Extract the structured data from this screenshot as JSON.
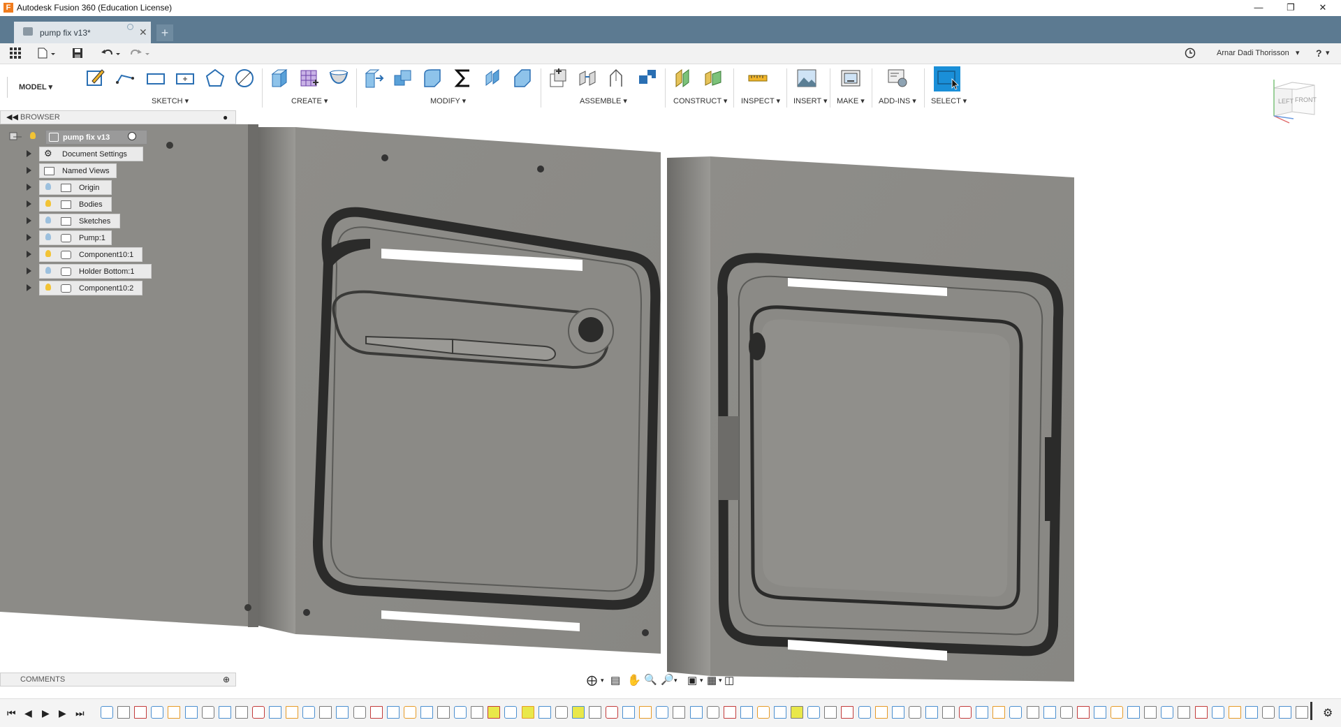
{
  "window": {
    "title": "Autodesk Fusion 360 (Education License)",
    "logo_letter": "F"
  },
  "tabs": [
    {
      "label": "pump fix v13*",
      "active": true
    }
  ],
  "quick_access": {
    "user_name": "Arnar Dadi Thorisson",
    "help_label": "?"
  },
  "toolbar": {
    "workspace": "MODEL",
    "groups": [
      "SKETCH",
      "CREATE",
      "MODIFY",
      "ASSEMBLE",
      "CONSTRUCT",
      "INSPECT",
      "INSERT",
      "MAKE",
      "ADD-INS",
      "SELECT"
    ],
    "accent": "#1a8fd8"
  },
  "viewcube": {
    "left": "LEFT",
    "front": "FRONT"
  },
  "browser": {
    "title": "BROWSER",
    "root": "pump fix v13",
    "items": [
      {
        "label": "Document Settings",
        "icon": "gear-icon"
      },
      {
        "label": "Named Views",
        "icon": "folder-icon"
      },
      {
        "label": "Origin",
        "icon": "folder-icon",
        "bulb": "off"
      },
      {
        "label": "Bodies",
        "icon": "folder-icon",
        "bulb": "on"
      },
      {
        "label": "Sketches",
        "icon": "folder-icon",
        "bulb": "off"
      },
      {
        "label": "Pump:1",
        "icon": "component-link-icon",
        "bulb": "off"
      },
      {
        "label": "Component10:1",
        "icon": "component-icon",
        "bulb": "on"
      },
      {
        "label": "Holder Bottom:1",
        "icon": "component-icon",
        "bulb": "off"
      },
      {
        "label": "Component10:2",
        "icon": "component-icon",
        "bulb": "on"
      }
    ]
  },
  "comments": {
    "title": "COMMENTS"
  },
  "colors": {
    "tab_bar": "#5c7a91",
    "model_grey": "#8e8d89",
    "bulb_on": "#f2c335",
    "bulb_off": "#9cc0de",
    "timeline_highlight": "#e9e84a"
  }
}
